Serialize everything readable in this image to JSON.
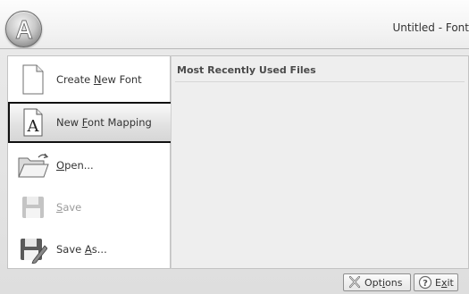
{
  "window": {
    "title": "Untitled - Font"
  },
  "menu": {
    "items": [
      {
        "pre": "Create ",
        "key": "N",
        "post": "ew Font",
        "icon": "new-document-icon",
        "enabled": true,
        "selected": false
      },
      {
        "pre": "New ",
        "key": "F",
        "post": "ont Mapping",
        "icon": "font-mapping-icon",
        "enabled": true,
        "selected": true
      },
      {
        "pre": "",
        "key": "O",
        "post": "pen...",
        "icon": "open-folder-icon",
        "enabled": true,
        "selected": false
      },
      {
        "pre": "",
        "key": "S",
        "post": "ave",
        "icon": "save-icon",
        "enabled": false,
        "selected": false
      },
      {
        "pre": "Save ",
        "key": "A",
        "post": "s...",
        "icon": "save-as-icon",
        "enabled": true,
        "selected": false
      }
    ]
  },
  "recent": {
    "heading": "Most Recently Used Files"
  },
  "footer": {
    "options": {
      "pre": "Opt",
      "key": "i",
      "post": "ons",
      "icon": "options-icon"
    },
    "exit": {
      "pre": "E",
      "key": "x",
      "post": "it",
      "icon": "help-exit-icon"
    }
  }
}
